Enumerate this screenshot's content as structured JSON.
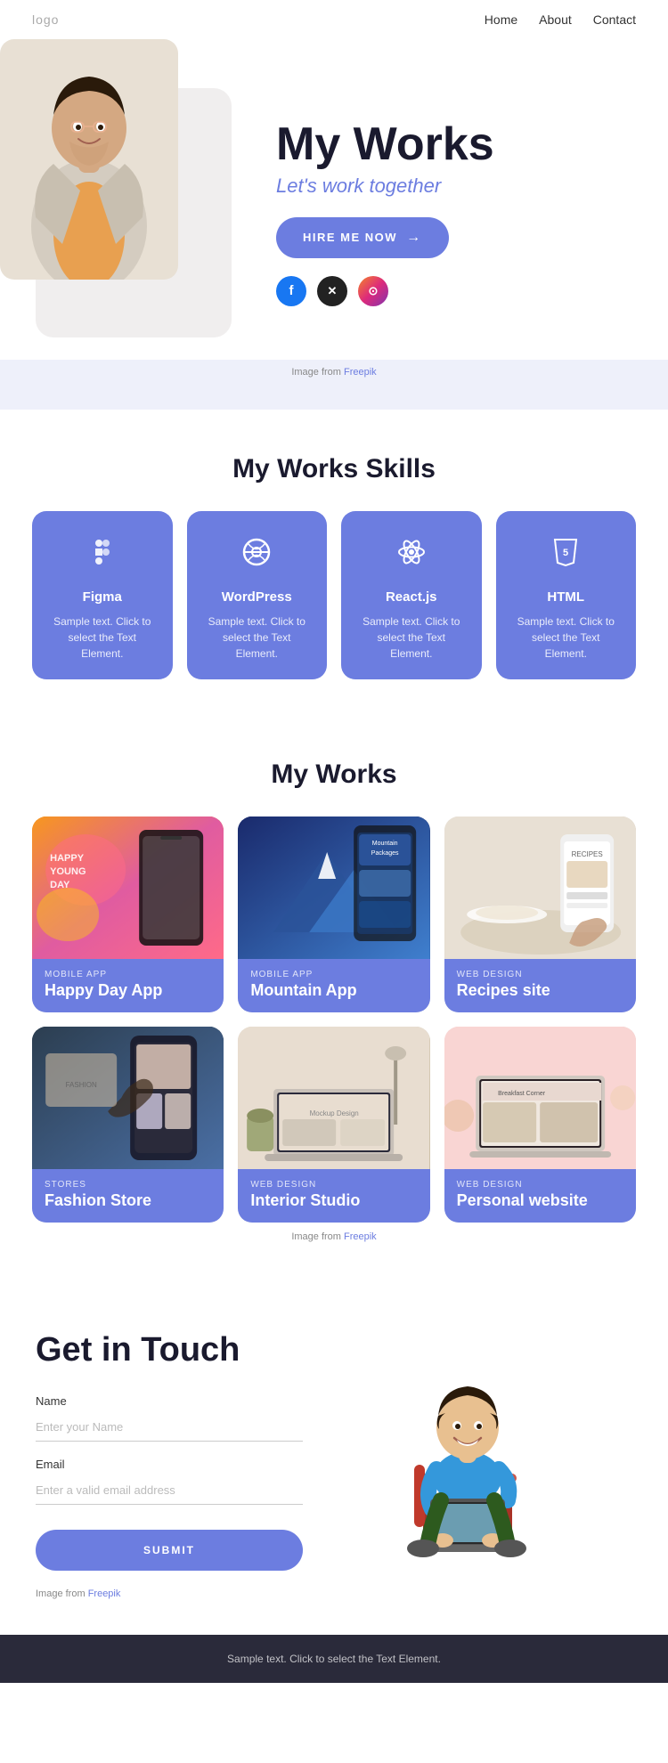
{
  "nav": {
    "logo": "logo",
    "links": [
      "Home",
      "About",
      "Contact"
    ]
  },
  "hero": {
    "title": "My Works",
    "subtitle": "Let's work together",
    "hire_btn": "HIRE ME NOW",
    "image_credit_prefix": "Image from ",
    "image_credit_link": "Freepik"
  },
  "skills_section": {
    "title": "My Works Skills",
    "skills": [
      {
        "name": "Figma",
        "icon": "✦",
        "desc": "Sample text. Click to select the Text Element."
      },
      {
        "name": "WordPress",
        "icon": "⊕",
        "desc": "Sample text. Click to select the Text Element."
      },
      {
        "name": "React.js",
        "icon": "⚛",
        "desc": "Sample text. Click to select the Text Element."
      },
      {
        "name": "HTML",
        "icon": "⬡",
        "desc": "Sample text. Click to select the Text Element."
      }
    ]
  },
  "works_section": {
    "title": "My Works",
    "works": [
      {
        "category": "MOBILE APP",
        "name": "Happy Day App"
      },
      {
        "category": "MOBILE APP",
        "name": "Mountain App"
      },
      {
        "category": "WEB DESIGN",
        "name": "Recipes site"
      },
      {
        "category": "STORES",
        "name": "Fashion Store"
      },
      {
        "category": "WEB DESIGN",
        "name": "Interior Studio"
      },
      {
        "category": "WEB DESIGN",
        "name": "Personal website"
      }
    ],
    "credit_prefix": "Image from ",
    "credit_link": "Freepik"
  },
  "contact_section": {
    "title": "Get in Touch",
    "name_label": "Name",
    "name_placeholder": "Enter your Name",
    "email_label": "Email",
    "email_placeholder": "Enter a valid email address",
    "submit_btn": "SUBMIT",
    "credit_prefix": "Image from ",
    "credit_link": "Freepik"
  },
  "footer": {
    "text": "Sample text. Click to select the Text Element."
  }
}
